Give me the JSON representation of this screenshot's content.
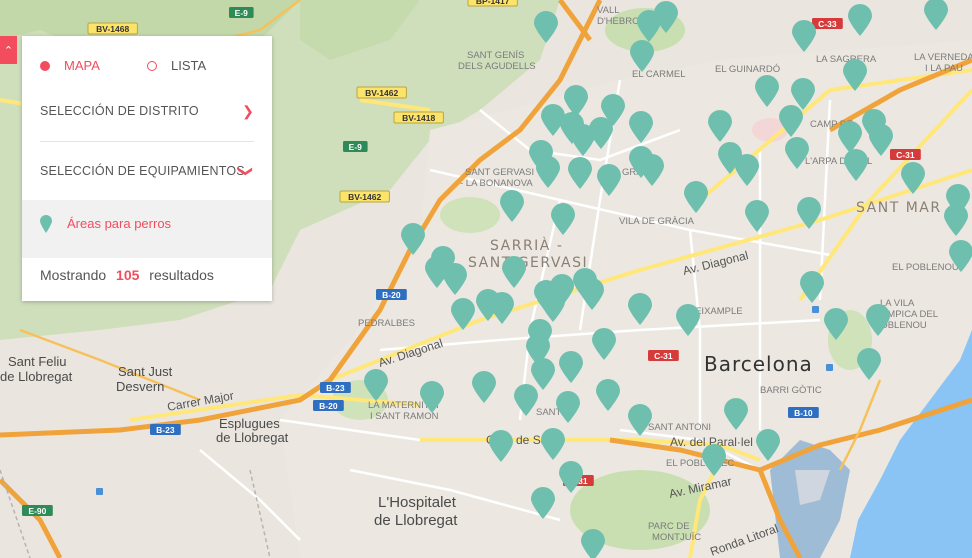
{
  "panel": {
    "collapse_icon": "chevron-up-icon",
    "tabs": [
      {
        "label": "MAPA",
        "active": true
      },
      {
        "label": "LISTA",
        "active": false
      }
    ],
    "district_label": "SELECCIÓN DE DISTRITO",
    "equipment_label": "SELECCIÓN DE EQUIPAMIENTOS",
    "filter_label": "Áreas para perros",
    "results_prefix": "Mostrando",
    "results_count": "105",
    "results_suffix": "resultados"
  },
  "colors": {
    "accent": "#f24c5d",
    "marker": "#6fbfae",
    "motorway": "#f0a33a",
    "road_yellow": "#ffe77a",
    "water": "#89c4f4",
    "park": "#c9dfb1"
  },
  "map": {
    "districts": [
      "SARRIÀ -",
      "SANT GERVASI",
      "SANT MAR"
    ],
    "city_label": "Barcelona",
    "towns": [
      "Sant Feliu",
      "de Llobregat",
      "Sant Just",
      "Desvern",
      "Esplugues",
      "de Llobregat",
      "L'Hospitalet",
      "de Llobregat"
    ],
    "neighborhoods": [
      "VALL",
      "D'HEBRON",
      "SANT GENÍS",
      "DELS AGUDELLS",
      "EL CARMEL",
      "EL GUINARDÓ",
      "LA SAGRERA",
      "LA VERNEDA",
      "I LA PAU",
      "SANT GERVASI",
      "- LA BONANOVA",
      "GRÀCIA",
      "VILA DE GRÀCIA",
      "CAMP DE",
      "L'ARPA DEL CL",
      "EL POBLENOU",
      "PEDRALBES",
      "LA MATERNITAT",
      "I SANT RAMON",
      "SANT ANTONI",
      "BARRI GÒTIC",
      "EL POBLE-SEC",
      "PARC DE",
      "MONTJUÏC",
      "LA VILA",
      "OLÍMPICA DEL",
      "POBLENOU",
      "L'EIXAMPLE",
      "SANTS"
    ],
    "roads": [
      "Av. Diagonal",
      "Av. Diagonal",
      "Carrer Major",
      "Av. del Paral·lel",
      "Av. Miramar",
      "Gran de Sants",
      "Ronda Litoral"
    ],
    "shields": [
      "E-9",
      "BV-1468",
      "BP-1417",
      "C-33",
      "BV-1462",
      "BV-1418",
      "E-9",
      "BV-1462",
      "B-20",
      "B-23",
      "B-20",
      "B-23",
      "C-31",
      "C-31",
      "C-31",
      "B-10",
      "E-90"
    ],
    "marker_icon": "map-pin-icon",
    "transit_icon": "bus-icon"
  }
}
